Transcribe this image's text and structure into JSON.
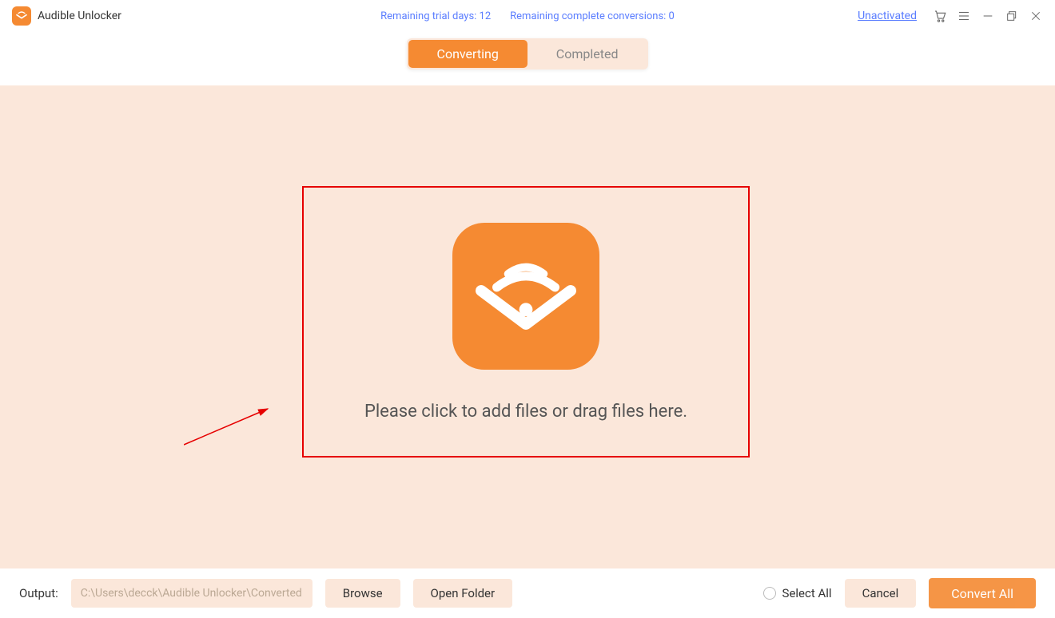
{
  "app": {
    "title": "Audible Unlocker"
  },
  "header": {
    "trial_days_label": "Remaining trial days: 12",
    "conversions_label": "Remaining complete conversions: 0",
    "unactivated": "Unactivated"
  },
  "tabs": {
    "converting": "Converting",
    "completed": "Completed"
  },
  "dropzone": {
    "text": "Please click to add files or drag files here."
  },
  "footer": {
    "output_label": "Output:",
    "output_path": "C:\\Users\\decck\\Audible Unlocker\\Converted",
    "browse": "Browse",
    "open_folder": "Open Folder",
    "select_all": "Select All",
    "cancel": "Cancel",
    "convert_all": "Convert All"
  }
}
